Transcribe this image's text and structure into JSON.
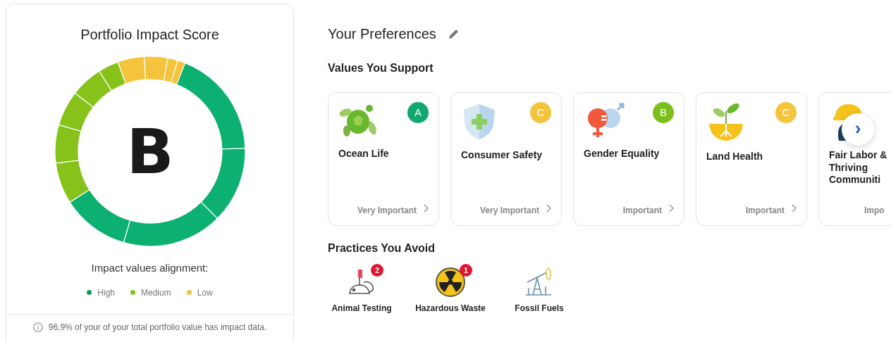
{
  "score_card": {
    "title": "Portfolio Impact Score",
    "grade": "B",
    "legend_title": "Impact values alignment:",
    "legend": [
      {
        "label": "High",
        "color": "#0c9b58"
      },
      {
        "label": "Medium",
        "color": "#86c21a"
      },
      {
        "label": "Low",
        "color": "#f4c43c"
      }
    ],
    "footer": "96.9% of your of your total portfolio value has impact data."
  },
  "preferences": {
    "title": "Your Preferences",
    "values_heading": "Values You Support",
    "values": [
      {
        "title": "Ocean Life",
        "grade": "A",
        "color": "#10a86c",
        "importance": "Very Important"
      },
      {
        "title": "Consumer Safety",
        "grade": "C",
        "color": "#f4c43c",
        "importance": "Very Important"
      },
      {
        "title": "Gender Equality",
        "grade": "B",
        "color": "#7cbf1c",
        "importance": "Important"
      },
      {
        "title": "Land Health",
        "grade": "C",
        "color": "#f4c43c",
        "importance": "Important"
      },
      {
        "title": "Fair Labor & Thriving Communiti",
        "importance": "Impo"
      }
    ],
    "next_button": "›",
    "avoid_heading": "Practices You Avoid",
    "avoid": [
      {
        "label": "Animal Testing",
        "count": "2"
      },
      {
        "label": "Hazardous Waste",
        "count": "1"
      },
      {
        "label": "Fossil Fuels"
      }
    ]
  }
}
